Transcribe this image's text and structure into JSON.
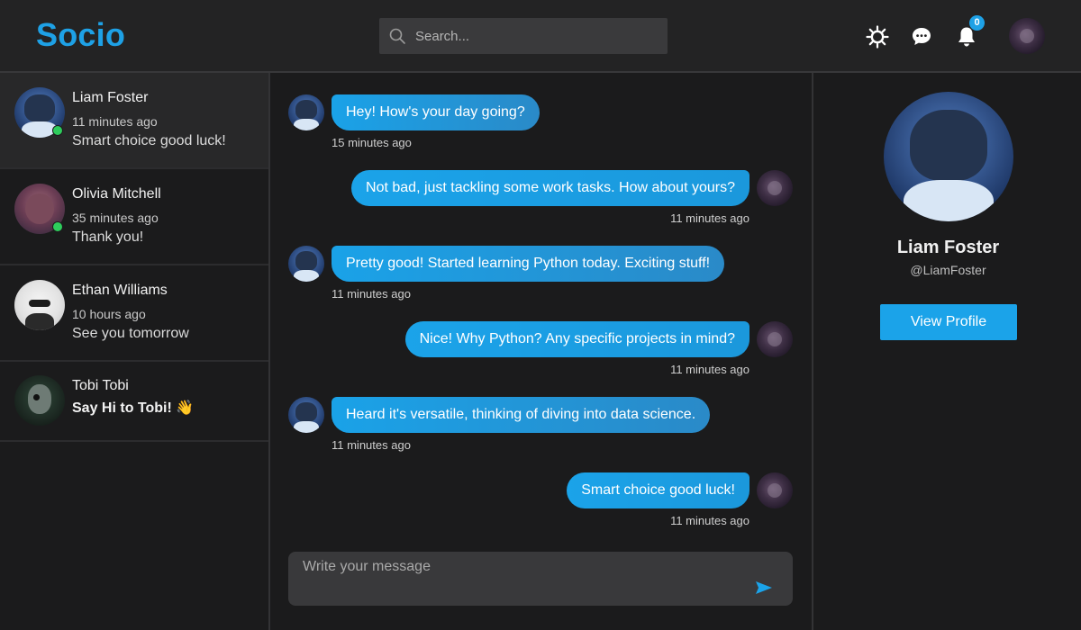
{
  "app": {
    "logo": "Socio"
  },
  "header": {
    "search_placeholder": "Search...",
    "notification_count": "0",
    "icons": [
      "theme-toggle-icon",
      "messages-icon",
      "bell-icon"
    ]
  },
  "colors": {
    "accent": "#1ea1e6",
    "online": "#2ecc5c",
    "background": "#1b1b1c"
  },
  "conversations": [
    {
      "name": "Liam Foster",
      "time": "11 minutes ago",
      "preview": "Smart choice good luck!",
      "online": true,
      "active": true
    },
    {
      "name": "Olivia Mitchell",
      "time": "35 minutes ago",
      "preview": "Thank you!",
      "online": true,
      "active": false
    },
    {
      "name": "Ethan Williams",
      "time": "10 hours ago",
      "preview": "See you tomorrow",
      "online": false,
      "active": false
    },
    {
      "name": "Tobi Tobi",
      "time": "",
      "preview": "Say Hi to Tobi! 👋",
      "online": false,
      "active": false
    }
  ],
  "messages": [
    {
      "direction": "in",
      "text": "Hey! How's your day going?",
      "time": "15 minutes ago"
    },
    {
      "direction": "out",
      "text": "Not bad, just tackling some work tasks. How about yours?",
      "time": "11 minutes ago"
    },
    {
      "direction": "in",
      "text": "Pretty good! Started learning Python today. Exciting stuff!",
      "time": "11 minutes ago"
    },
    {
      "direction": "out",
      "text": "Nice! Why Python? Any specific projects in mind?",
      "time": "11 minutes ago"
    },
    {
      "direction": "in",
      "text": "Heard it's versatile, thinking of diving into data science.",
      "time": "11 minutes ago"
    },
    {
      "direction": "out",
      "text": "Smart choice good luck!",
      "time": "11 minutes ago"
    }
  ],
  "composer": {
    "placeholder": "Write your message"
  },
  "profile": {
    "name": "Liam Foster",
    "handle": "@LiamFoster",
    "button": "View Profile"
  }
}
